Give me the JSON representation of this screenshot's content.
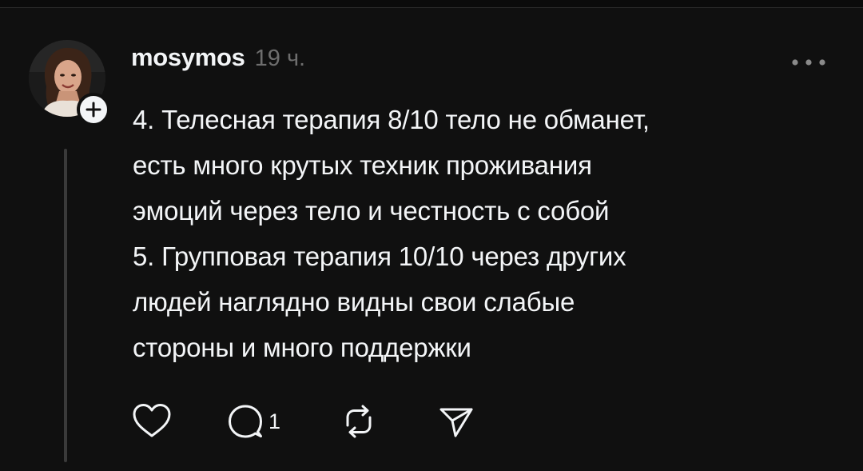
{
  "post": {
    "author": {
      "username": "mosymos"
    },
    "timestamp": "19 ч.",
    "body_lines": [
      "4. Телесная терапия 8/10 тело не обманет,",
      "есть много крутых техник проживания",
      "эмоций через тело и честность с собой",
      "5. Групповая терапия 10/10 через других",
      "людей наглядно видны свои слабые",
      "стороны и много поддержки"
    ],
    "actions": {
      "reply_count": "1"
    }
  },
  "icons": {
    "follow": "plus-icon",
    "more": "ellipsis-icon",
    "like": "heart-icon",
    "reply": "comment-bubble-icon",
    "repost": "repost-icon",
    "share": "paper-plane-icon"
  },
  "colors": {
    "background": "#101010",
    "text": "#f3f5f7",
    "secondary_text": "#6e6e6e",
    "thread_line": "#3a3a3a"
  }
}
